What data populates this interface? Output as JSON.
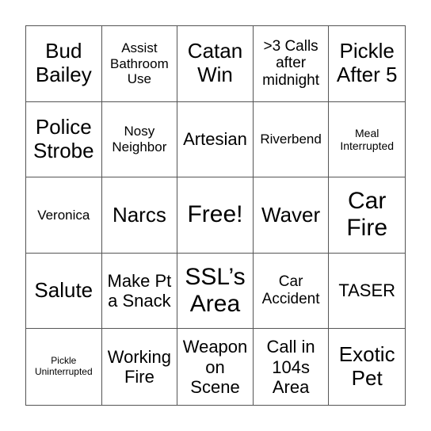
{
  "board": {
    "rows": [
      [
        {
          "text": "Bud Bailey",
          "size": "lg"
        },
        {
          "text": "Assist Bathroom Use",
          "size": "xs"
        },
        {
          "text": "Catan Win",
          "size": "lg"
        },
        {
          "text": ">3 Calls after midnight",
          "size": "sm"
        },
        {
          "text": "Pickle After 5",
          "size": "lg"
        }
      ],
      [
        {
          "text": "Police Strobe",
          "size": "lg"
        },
        {
          "text": "Nosy Neighbor",
          "size": "xs"
        },
        {
          "text": "Artesian",
          "size": "md"
        },
        {
          "text": "Riverbend",
          "size": "xs"
        },
        {
          "text": "Meal Interrupted",
          "size": "xxs"
        }
      ],
      [
        {
          "text": "Veronica",
          "size": "xs"
        },
        {
          "text": "Narcs",
          "size": "lg"
        },
        {
          "text": "Free!",
          "size": "xl"
        },
        {
          "text": "Waver",
          "size": "lg"
        },
        {
          "text": "Car Fire",
          "size": "xl"
        }
      ],
      [
        {
          "text": "Salute",
          "size": "lg"
        },
        {
          "text": "Make Pt a Snack",
          "size": "md"
        },
        {
          "text": "SSL’s Area",
          "size": "xl"
        },
        {
          "text": "Car Accident",
          "size": "sm"
        },
        {
          "text": "TASER",
          "size": "md"
        }
      ],
      [
        {
          "text": "Pickle Uninterrupted",
          "size": "tiny"
        },
        {
          "text": "Working Fire",
          "size": "md"
        },
        {
          "text": "Weapon on Scene",
          "size": "md"
        },
        {
          "text": "Call in 104s Area",
          "size": "md"
        },
        {
          "text": "Exotic Pet",
          "size": "lg"
        }
      ]
    ]
  }
}
